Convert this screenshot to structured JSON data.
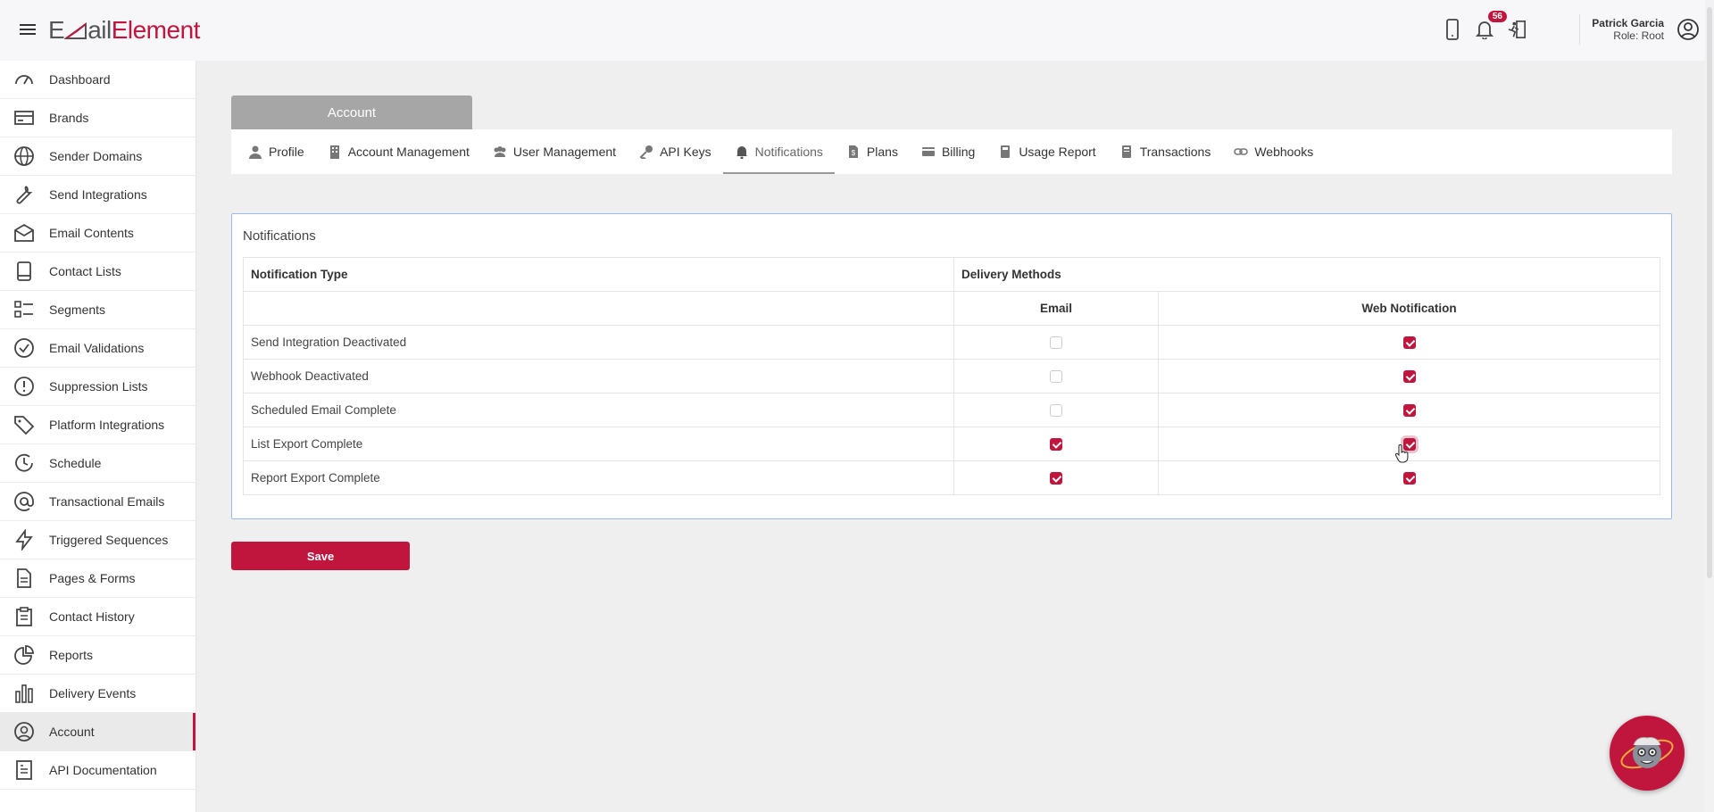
{
  "header": {
    "logo_part1": "E",
    "logo_part2": "ail",
    "logo_part3": "Element",
    "notification_count": "56",
    "user_name": "Patrick Garcia",
    "user_role": "Role: Root",
    "brand_color": "#c0163e"
  },
  "sidebar": {
    "items": [
      {
        "label": "Dashboard",
        "icon": "gauge-icon"
      },
      {
        "label": "Brands",
        "icon": "card-icon"
      },
      {
        "label": "Sender Domains",
        "icon": "globe-icon"
      },
      {
        "label": "Send Integrations",
        "icon": "wrench-icon"
      },
      {
        "label": "Email Contents",
        "icon": "envelope-icon"
      },
      {
        "label": "Contact Lists",
        "icon": "book-icon"
      },
      {
        "label": "Segments",
        "icon": "list-icon"
      },
      {
        "label": "Email Validations",
        "icon": "check-circle-icon"
      },
      {
        "label": "Suppression Lists",
        "icon": "alert-circle-icon"
      },
      {
        "label": "Platform Integrations",
        "icon": "tag-icon"
      },
      {
        "label": "Schedule",
        "icon": "clock-icon"
      },
      {
        "label": "Transactional Emails",
        "icon": "at-icon"
      },
      {
        "label": "Triggered Sequences",
        "icon": "bolt-icon"
      },
      {
        "label": "Pages & Forms",
        "icon": "file-icon"
      },
      {
        "label": "Contact History",
        "icon": "clipboard-icon"
      },
      {
        "label": "Reports",
        "icon": "pie-icon"
      },
      {
        "label": "Delivery Events",
        "icon": "bars-icon"
      },
      {
        "label": "Account",
        "icon": "user-circle-icon"
      },
      {
        "label": "API Documentation",
        "icon": "doc-icon"
      }
    ],
    "active_index": 17
  },
  "account_tab": "Account",
  "tabs": [
    {
      "label": "Profile",
      "icon": "person-icon"
    },
    {
      "label": "Account Management",
      "icon": "building-icon"
    },
    {
      "label": "User Management",
      "icon": "users-icon"
    },
    {
      "label": "API Keys",
      "icon": "key-icon"
    },
    {
      "label": "Notifications",
      "icon": "bell-icon"
    },
    {
      "label": "Plans",
      "icon": "file-dollar-icon"
    },
    {
      "label": "Billing",
      "icon": "credit-card-icon"
    },
    {
      "label": "Usage Report",
      "icon": "calculator-icon"
    },
    {
      "label": "Transactions",
      "icon": "receipt-icon"
    },
    {
      "label": "Webhooks",
      "icon": "link-icon"
    }
  ],
  "active_tab": 4,
  "notifications": {
    "title": "Notifications",
    "col_type": "Notification Type",
    "col_methods": "Delivery Methods",
    "col_email": "Email",
    "col_web": "Web Notification",
    "rows": [
      {
        "label": "Send Integration Deactivated",
        "email": false,
        "web": true
      },
      {
        "label": "Webhook Deactivated",
        "email": false,
        "web": true
      },
      {
        "label": "Scheduled Email Complete",
        "email": false,
        "web": true
      },
      {
        "label": "List Export Complete",
        "email": true,
        "web": true
      },
      {
        "label": "Report Export Complete",
        "email": true,
        "web": true
      }
    ]
  },
  "save_label": "Save"
}
